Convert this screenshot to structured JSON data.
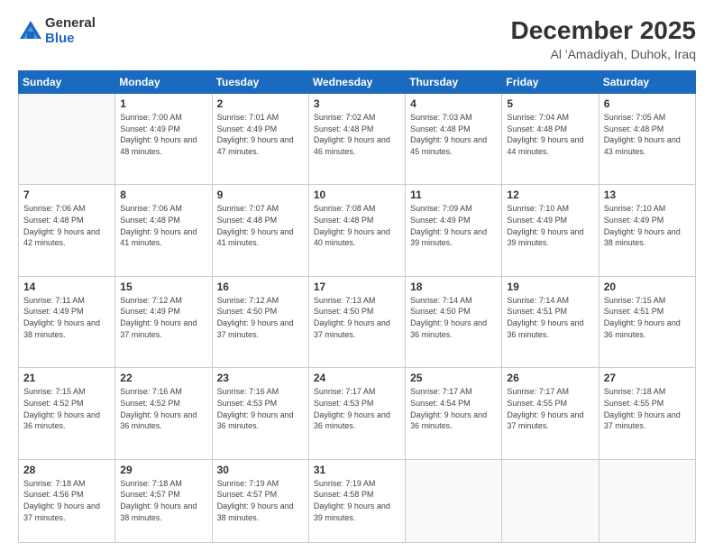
{
  "logo": {
    "general": "General",
    "blue": "Blue"
  },
  "header": {
    "month": "December 2025",
    "location": "Al 'Amadiyah, Duhok, Iraq"
  },
  "weekdays": [
    "Sunday",
    "Monday",
    "Tuesday",
    "Wednesday",
    "Thursday",
    "Friday",
    "Saturday"
  ],
  "weeks": [
    [
      {
        "day": "",
        "sunrise": "",
        "sunset": "",
        "daylight": ""
      },
      {
        "day": "1",
        "sunrise": "7:00 AM",
        "sunset": "4:49 PM",
        "daylight": "9 hours and 48 minutes."
      },
      {
        "day": "2",
        "sunrise": "7:01 AM",
        "sunset": "4:49 PM",
        "daylight": "9 hours and 47 minutes."
      },
      {
        "day": "3",
        "sunrise": "7:02 AM",
        "sunset": "4:48 PM",
        "daylight": "9 hours and 46 minutes."
      },
      {
        "day": "4",
        "sunrise": "7:03 AM",
        "sunset": "4:48 PM",
        "daylight": "9 hours and 45 minutes."
      },
      {
        "day": "5",
        "sunrise": "7:04 AM",
        "sunset": "4:48 PM",
        "daylight": "9 hours and 44 minutes."
      },
      {
        "day": "6",
        "sunrise": "7:05 AM",
        "sunset": "4:48 PM",
        "daylight": "9 hours and 43 minutes."
      }
    ],
    [
      {
        "day": "7",
        "sunrise": "7:06 AM",
        "sunset": "4:48 PM",
        "daylight": "9 hours and 42 minutes."
      },
      {
        "day": "8",
        "sunrise": "7:06 AM",
        "sunset": "4:48 PM",
        "daylight": "9 hours and 41 minutes."
      },
      {
        "day": "9",
        "sunrise": "7:07 AM",
        "sunset": "4:48 PM",
        "daylight": "9 hours and 41 minutes."
      },
      {
        "day": "10",
        "sunrise": "7:08 AM",
        "sunset": "4:48 PM",
        "daylight": "9 hours and 40 minutes."
      },
      {
        "day": "11",
        "sunrise": "7:09 AM",
        "sunset": "4:49 PM",
        "daylight": "9 hours and 39 minutes."
      },
      {
        "day": "12",
        "sunrise": "7:10 AM",
        "sunset": "4:49 PM",
        "daylight": "9 hours and 39 minutes."
      },
      {
        "day": "13",
        "sunrise": "7:10 AM",
        "sunset": "4:49 PM",
        "daylight": "9 hours and 38 minutes."
      }
    ],
    [
      {
        "day": "14",
        "sunrise": "7:11 AM",
        "sunset": "4:49 PM",
        "daylight": "9 hours and 38 minutes."
      },
      {
        "day": "15",
        "sunrise": "7:12 AM",
        "sunset": "4:49 PM",
        "daylight": "9 hours and 37 minutes."
      },
      {
        "day": "16",
        "sunrise": "7:12 AM",
        "sunset": "4:50 PM",
        "daylight": "9 hours and 37 minutes."
      },
      {
        "day": "17",
        "sunrise": "7:13 AM",
        "sunset": "4:50 PM",
        "daylight": "9 hours and 37 minutes."
      },
      {
        "day": "18",
        "sunrise": "7:14 AM",
        "sunset": "4:50 PM",
        "daylight": "9 hours and 36 minutes."
      },
      {
        "day": "19",
        "sunrise": "7:14 AM",
        "sunset": "4:51 PM",
        "daylight": "9 hours and 36 minutes."
      },
      {
        "day": "20",
        "sunrise": "7:15 AM",
        "sunset": "4:51 PM",
        "daylight": "9 hours and 36 minutes."
      }
    ],
    [
      {
        "day": "21",
        "sunrise": "7:15 AM",
        "sunset": "4:52 PM",
        "daylight": "9 hours and 36 minutes."
      },
      {
        "day": "22",
        "sunrise": "7:16 AM",
        "sunset": "4:52 PM",
        "daylight": "9 hours and 36 minutes."
      },
      {
        "day": "23",
        "sunrise": "7:16 AM",
        "sunset": "4:53 PM",
        "daylight": "9 hours and 36 minutes."
      },
      {
        "day": "24",
        "sunrise": "7:17 AM",
        "sunset": "4:53 PM",
        "daylight": "9 hours and 36 minutes."
      },
      {
        "day": "25",
        "sunrise": "7:17 AM",
        "sunset": "4:54 PM",
        "daylight": "9 hours and 36 minutes."
      },
      {
        "day": "26",
        "sunrise": "7:17 AM",
        "sunset": "4:55 PM",
        "daylight": "9 hours and 37 minutes."
      },
      {
        "day": "27",
        "sunrise": "7:18 AM",
        "sunset": "4:55 PM",
        "daylight": "9 hours and 37 minutes."
      }
    ],
    [
      {
        "day": "28",
        "sunrise": "7:18 AM",
        "sunset": "4:56 PM",
        "daylight": "9 hours and 37 minutes."
      },
      {
        "day": "29",
        "sunrise": "7:18 AM",
        "sunset": "4:57 PM",
        "daylight": "9 hours and 38 minutes."
      },
      {
        "day": "30",
        "sunrise": "7:19 AM",
        "sunset": "4:57 PM",
        "daylight": "9 hours and 38 minutes."
      },
      {
        "day": "31",
        "sunrise": "7:19 AM",
        "sunset": "4:58 PM",
        "daylight": "9 hours and 39 minutes."
      },
      {
        "day": "",
        "sunrise": "",
        "sunset": "",
        "daylight": ""
      },
      {
        "day": "",
        "sunrise": "",
        "sunset": "",
        "daylight": ""
      },
      {
        "day": "",
        "sunrise": "",
        "sunset": "",
        "daylight": ""
      }
    ]
  ],
  "labels": {
    "sunrise": "Sunrise:",
    "sunset": "Sunset:",
    "daylight": "Daylight:"
  }
}
